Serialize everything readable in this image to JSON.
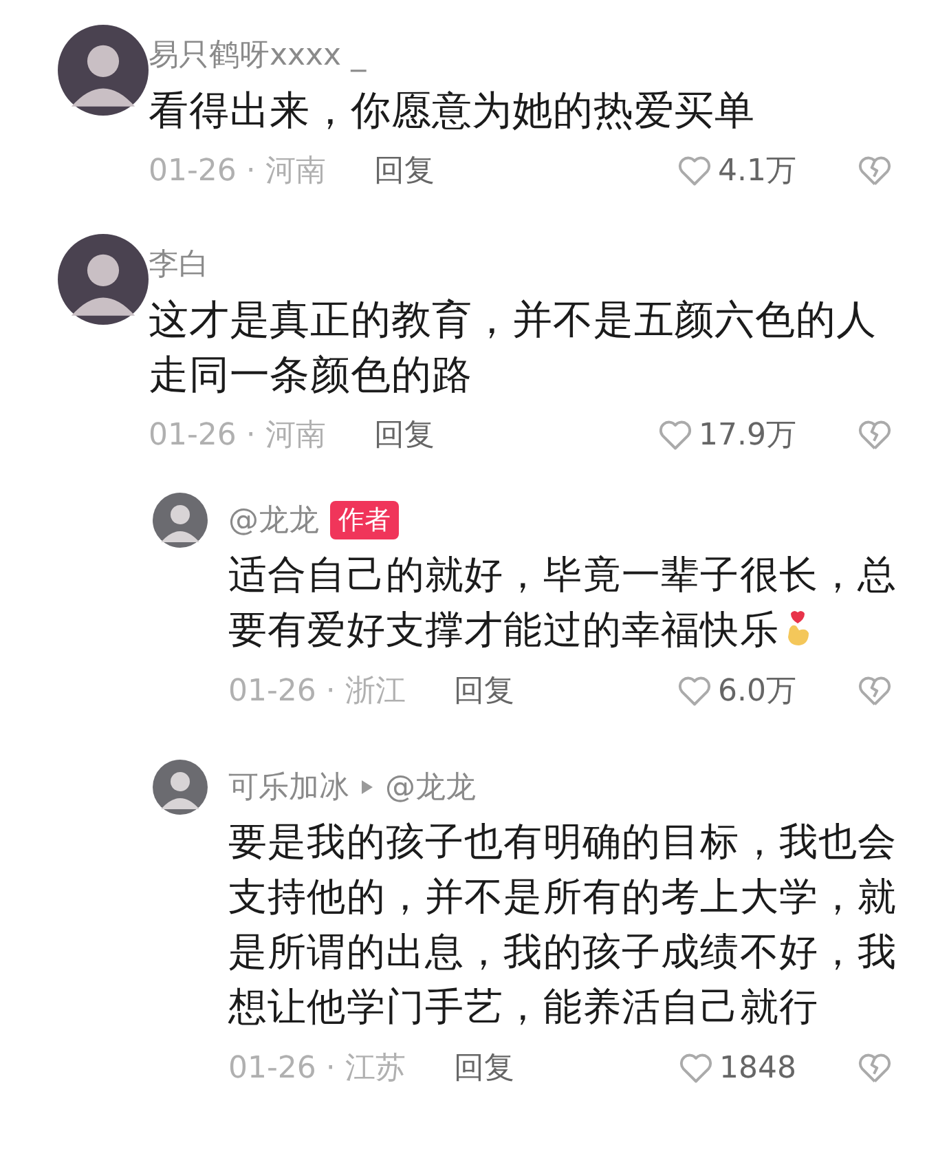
{
  "comments": [
    {
      "user": "易只鹤呀xxxx _",
      "text": "看得出来，你愿意为她的热爱买单",
      "meta": "01-26 · 河南",
      "reply": "回复",
      "likes": "4.1万"
    },
    {
      "user": "李白",
      "text": "这才是真正的教育，并不是五颜六色的人走同一条颜色的路",
      "meta": "01-26 · 河南",
      "reply": "回复",
      "likes": "17.9万",
      "children": [
        {
          "user": "@龙龙",
          "badge": "作者",
          "text": "适合自己的就好，毕竟一辈子很长，总要有爱好支撑才能过的幸福快乐",
          "finger_heart_emoji": true,
          "meta": "01-26 · 浙江",
          "reply": "回复",
          "likes": "6.0万"
        },
        {
          "user": "可乐加冰",
          "reply_to": "@龙龙",
          "text": "要是我的孩子也有明确的目标，我也会支持他的，并不是所有的考上大学，就是所谓的出息，我的孩子成绩不好，我想让他学门手艺，能养活自己就行",
          "meta": "01-26 · 江苏",
          "reply": "回复",
          "likes": "1848"
        }
      ]
    }
  ]
}
